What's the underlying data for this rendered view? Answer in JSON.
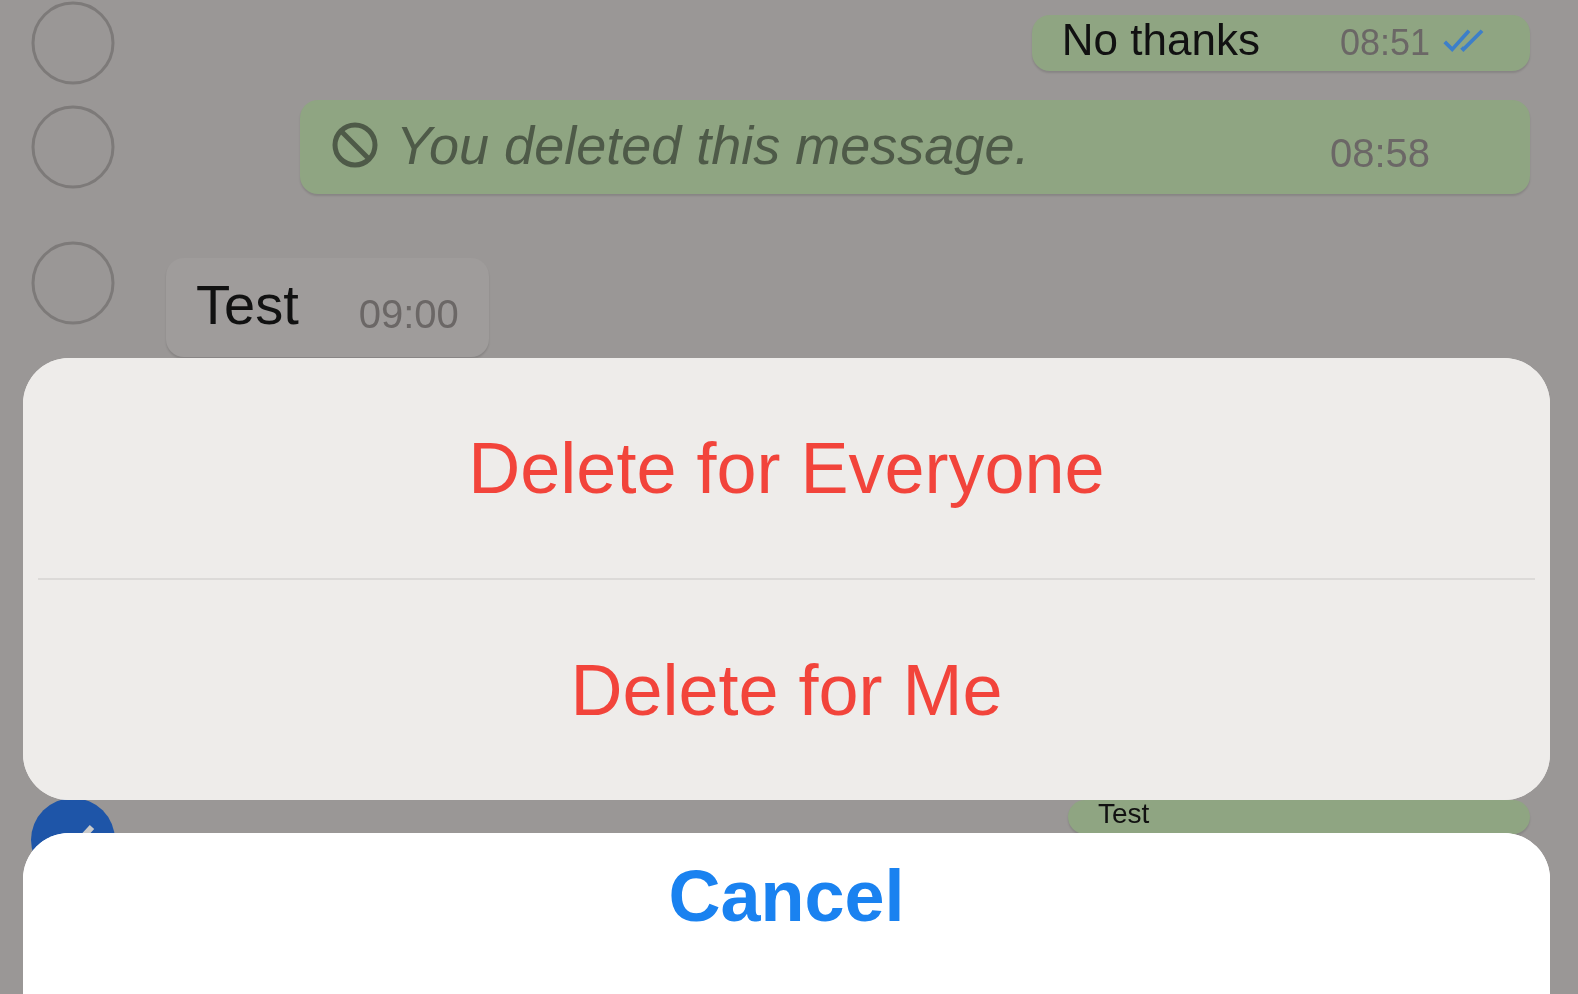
{
  "messages": [
    {
      "kind": "outgoing",
      "text": "No thanks",
      "time": "08:51",
      "read": true,
      "selected": false
    },
    {
      "kind": "deleted",
      "text": "You deleted this message.",
      "time": "08:58",
      "selected": false
    },
    {
      "kind": "incoming",
      "text": "Test",
      "time": "09:00",
      "selected": false
    },
    {
      "kind": "outgoing",
      "text": "Test",
      "selected": true
    }
  ],
  "action_sheet": {
    "actions": [
      "Delete for Everyone",
      "Delete for Me"
    ],
    "cancel": "Cancel"
  }
}
